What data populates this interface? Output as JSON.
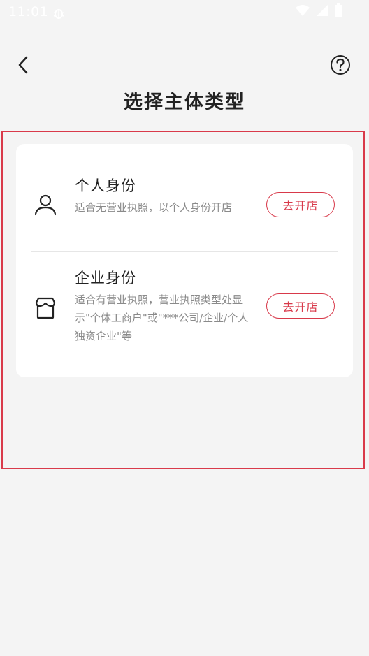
{
  "status_bar": {
    "time": "11:01",
    "notification_icon": "bug-icon",
    "icons": [
      "wifi-icon",
      "cellular-signal-icon",
      "battery-icon"
    ]
  },
  "header": {
    "back_icon": "chevron-left-icon",
    "help_icon": "question-circle-icon",
    "title": "选择主体类型"
  },
  "options": [
    {
      "icon": "person-icon",
      "title": "个人身份",
      "description": "适合无营业执照，以个人身份开店",
      "button_label": "去开店"
    },
    {
      "icon": "storefront-icon",
      "title": "企业身份",
      "description": "适合有营业执照，营业执照类型处显示\"个体工商户\"或\"***公司/企业/个人独资企业\"等",
      "button_label": "去开店"
    }
  ],
  "colors": {
    "accent": "#d8394a",
    "background": "#f4f4f4",
    "card": "#ffffff",
    "highlight_frame": "#d93a4a"
  }
}
